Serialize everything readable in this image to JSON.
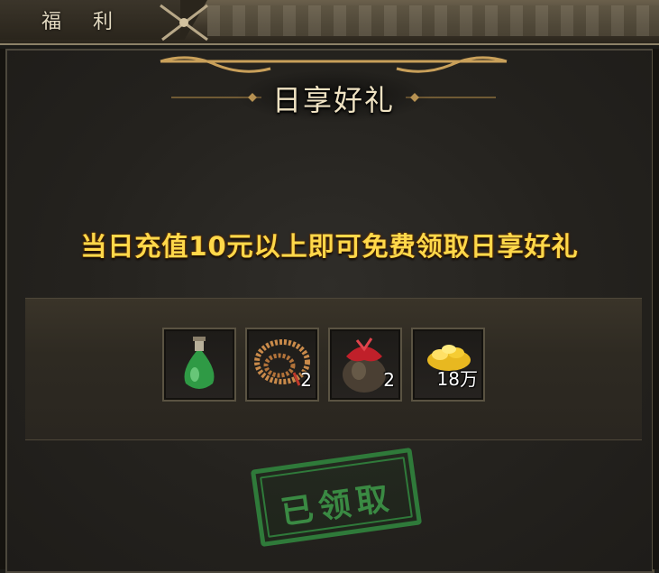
{
  "tab": {
    "label": "福 利"
  },
  "banner": {
    "title": "日享好礼"
  },
  "subtitle": "当日充值10元以上即可免费领取日享好礼",
  "rewards": [
    {
      "icon": "green-potion-icon",
      "count": ""
    },
    {
      "icon": "prayer-beads-icon",
      "count": "2"
    },
    {
      "icon": "wine-jar-icon",
      "count": "2"
    },
    {
      "icon": "gold-coins-icon",
      "count": "18万"
    }
  ],
  "stamp": {
    "label": "已领取"
  },
  "colors": {
    "subtitle": "#ffd84a",
    "stamp": "#2f7a3a",
    "banner_gold": "#c9a05a"
  }
}
